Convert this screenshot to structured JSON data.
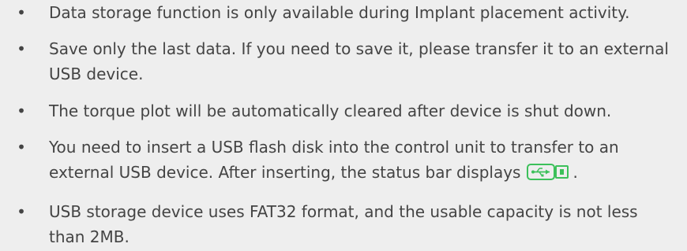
{
  "bullet_symbol": "•",
  "notes": [
    {
      "text": "Data storage function is only available during Implant placement activity."
    },
    {
      "text": "Save only the last data. If you need to save it, please transfer it to an external USB device."
    },
    {
      "text": "The torque plot will be automatically cleared after device is shut down."
    },
    {
      "text": "You need to insert a USB flash disk into the control unit to transfer to an external USB device. After inserting, the status bar displays",
      "icon": "usb-connected-icon",
      "after_icon": "."
    },
    {
      "text": "USB storage device uses FAT32  format, and the usable capacity is not less than 2MB."
    }
  ],
  "colors": {
    "background": "#eeeeee",
    "text": "#444444",
    "icon_accent": "#3cc05a"
  }
}
